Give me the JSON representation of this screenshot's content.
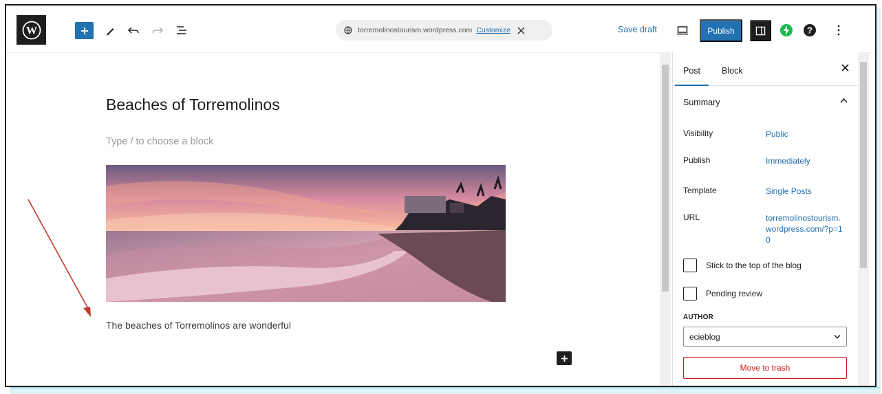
{
  "toolbar": {
    "url": "torremolinostourism.wordpress.com",
    "customize_label": "Customize",
    "save_draft_label": "Save draft",
    "publish_label": "Publish"
  },
  "editor": {
    "title": "Beaches of Torremolinos",
    "placeholder": "Type / to choose a block",
    "caption": "The beaches of Torremolinos are wonderful"
  },
  "sidebar": {
    "tabs": [
      {
        "label": "Post",
        "active": true
      },
      {
        "label": "Block",
        "active": false
      }
    ],
    "summary_title": "Summary",
    "rows": [
      {
        "label": "Visibility",
        "value": "Public"
      },
      {
        "label": "Publish",
        "value": "Immediately"
      },
      {
        "label": "Template",
        "value": "Single Posts"
      },
      {
        "label": "URL",
        "value": "torremolinostourism.wordpress.com/?p=10"
      }
    ],
    "stick_label": "Stick to the top of the blog",
    "pending_label": "Pending review",
    "author_label": "AUTHOR",
    "author_value": "ecieblog",
    "trash_label": "Move to trash"
  },
  "colors": {
    "accent": "#2271b1",
    "danger": "#cc1818",
    "boost_green": "#1db954",
    "annotation_arrow": "#c0392b"
  },
  "icons": [
    "wordpress-logo-icon",
    "plus-icon",
    "pen-icon",
    "undo-icon",
    "redo-icon",
    "list-view-icon",
    "globe-icon",
    "close-icon",
    "desktop-preview-icon",
    "sidebar-toggle-icon",
    "jetpack-bolt-icon",
    "help-icon",
    "more-vertical-icon",
    "chevron-up-icon",
    "chevron-down-icon"
  ]
}
